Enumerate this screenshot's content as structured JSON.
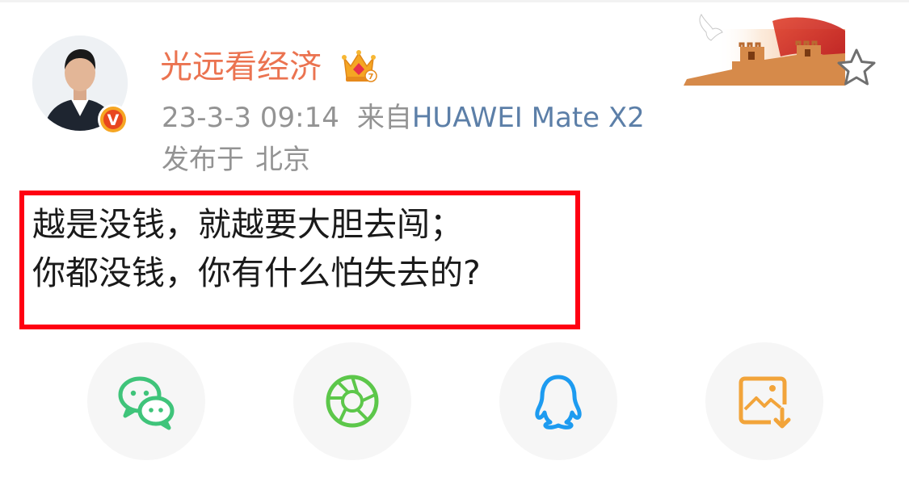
{
  "post": {
    "username": "光远看经济",
    "timestamp": "23-3-3 09:14",
    "source_prefix": "来自",
    "device": "HUAWEI Mate X2",
    "location_prefix": "发布于",
    "location": "北京",
    "body_lines": [
      "越是没钱，就越要大胆去闯；",
      "你都没钱，你有什么怕失去的?"
    ],
    "verified_badge": "V"
  },
  "share": {
    "items": [
      {
        "icon": "wechat-icon",
        "color": "#3fc47a"
      },
      {
        "icon": "moments-icon",
        "color": "#5cc74a"
      },
      {
        "icon": "qq-icon",
        "color": "#1d9bf0"
      },
      {
        "icon": "save-image-icon",
        "color": "#f2a43a"
      }
    ]
  },
  "colors": {
    "username": "#eb7350",
    "meta": "#939393",
    "device_link": "#5c7fa8",
    "highlight_box": "#ff0012"
  }
}
